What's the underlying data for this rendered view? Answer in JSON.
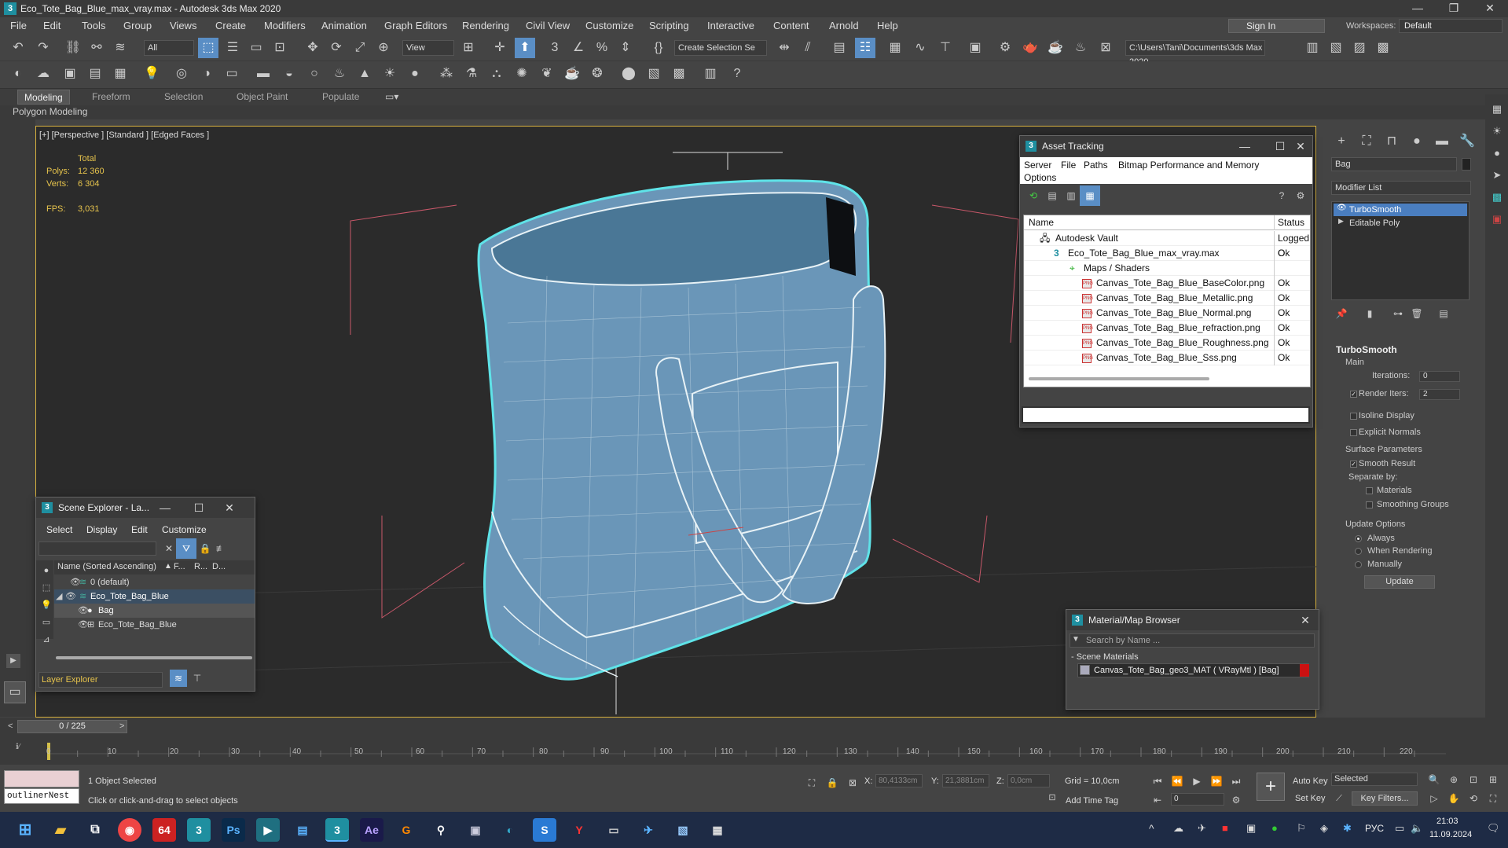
{
  "app": {
    "title": "Eco_Tote_Bag_Blue_max_vray.max - Autodesk 3ds Max 2020",
    "logo": "3",
    "menu": [
      "File",
      "Edit",
      "Tools",
      "Group",
      "Views",
      "Create",
      "Modifiers",
      "Animation",
      "Graph Editors",
      "Rendering",
      "Civil View",
      "Customize",
      "Scripting",
      "Interactive",
      "Content",
      "Arnold",
      "Help"
    ],
    "sign_in": "Sign In",
    "workspaces_label": "Workspaces:",
    "workspace": "Default"
  },
  "toolbar": {
    "selection_filter": "All",
    "ref_coord": "View",
    "named_selection": "Create Selection Se",
    "project_path": "C:\\Users\\Tani\\Documents\\3ds Max 2020"
  },
  "ribbon": {
    "tabs": [
      "Modeling",
      "Freeform",
      "Selection",
      "Object Paint",
      "Populate"
    ],
    "sub": "Polygon Modeling"
  },
  "viewport": {
    "label": "[+] [Perspective ] [Standard ] [Edged Faces ]",
    "stats": {
      "total_label": "Total",
      "polys_label": "Polys:",
      "polys": "12 360",
      "verts_label": "Verts:",
      "verts": "6 304",
      "fps_label": "FPS:",
      "fps": "3,031"
    }
  },
  "command_panel": {
    "object_name": "Bag",
    "modifier_list": "Modifier List",
    "stack": [
      "TurboSmooth",
      "Editable Poly"
    ],
    "rollout_title": "TurboSmooth",
    "main_label": "Main",
    "iterations_label": "Iterations:",
    "iterations": "0",
    "render_iters_label": "Render Iters:",
    "render_iters": "2",
    "isoline": "Isoline Display",
    "explicit_normals": "Explicit Normals",
    "surface_params": "Surface Parameters",
    "smooth_result": "Smooth Result",
    "separate_by": "Separate by:",
    "materials": "Materials",
    "smoothing_groups": "Smoothing Groups",
    "update_options": "Update Options",
    "always": "Always",
    "when_rendering": "When Rendering",
    "manually": "Manually",
    "update_button": "Update"
  },
  "asset_tracking": {
    "title": "Asset Tracking",
    "menu": [
      "Server",
      "File",
      "Paths",
      "Bitmap Performance and Memory"
    ],
    "menu2": "Options",
    "col_name": "Name",
    "col_status": "Status",
    "rows": [
      {
        "name": "Autodesk Vault",
        "status": "Logged O"
      },
      {
        "name": "Eco_Tote_Bag_Blue_max_vray.max",
        "status": "Ok"
      },
      {
        "name": "Maps / Shaders",
        "status": ""
      },
      {
        "name": "Canvas_Tote_Bag_Blue_BaseColor.png",
        "status": "Ok"
      },
      {
        "name": "Canvas_Tote_Bag_Blue_Metallic.png",
        "status": "Ok"
      },
      {
        "name": "Canvas_Tote_Bag_Blue_Normal.png",
        "status": "Ok"
      },
      {
        "name": "Canvas_Tote_Bag_Blue_refraction.png",
        "status": "Ok"
      },
      {
        "name": "Canvas_Tote_Bag_Blue_Roughness.png",
        "status": "Ok"
      },
      {
        "name": "Canvas_Tote_Bag_Blue_Sss.png",
        "status": "Ok"
      }
    ]
  },
  "scene_explorer": {
    "title": "Scene Explorer - La...",
    "menu": [
      "Select",
      "Display",
      "Edit",
      "Customize"
    ],
    "col_name": "Name (Sorted Ascending)",
    "col_f": "F...",
    "col_r": "R...",
    "col_d": "D...",
    "rows": [
      "0 (default)",
      "Eco_Tote_Bag_Blue",
      "Bag",
      "Eco_Tote_Bag_Blue"
    ],
    "layer_explorer": "Layer Explorer"
  },
  "material_browser": {
    "title": "Material/Map Browser",
    "search_placeholder": "Search by Name ...",
    "section": "- Scene Materials",
    "material": "Canvas_Tote_Bag_geo3_MAT ( VRayMtl ) [Bag]"
  },
  "timeline": {
    "frame": "0 / 225",
    "ticks": [
      "0",
      "10",
      "20",
      "30",
      "40",
      "50",
      "60",
      "70",
      "80",
      "90",
      "100",
      "110",
      "120",
      "130",
      "140",
      "150",
      "160",
      "170",
      "180",
      "190",
      "200",
      "210",
      "220"
    ]
  },
  "status": {
    "selected": "1 Object Selected",
    "prompt": "Click or click-and-drag to select objects",
    "maxscript": "outlinerNest",
    "x_label": "X:",
    "x": "80,4133cm",
    "y_label": "Y:",
    "y": "21,3881cm",
    "z_label": "Z:",
    "z": "0,0cm",
    "grid": "Grid = 10,0cm",
    "add_time_tag": "Add Time Tag",
    "auto_key": "Auto Key",
    "set_key": "Set Key",
    "key_mode": "Selected",
    "key_filters": "Key Filters...",
    "frame_field": "0"
  },
  "taskbar": {
    "lang": "РУС",
    "time": "21:03",
    "date": "11.09.2024"
  }
}
